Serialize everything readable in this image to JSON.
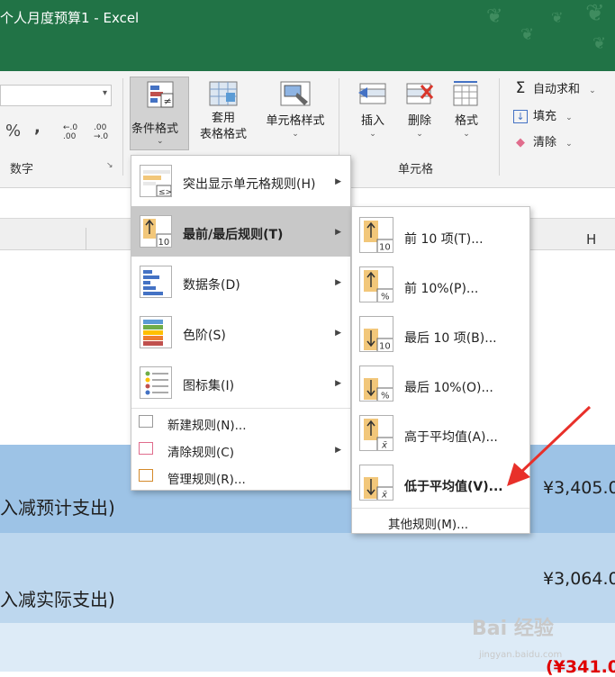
{
  "window": {
    "title": "个人月度预算1  -  Excel"
  },
  "ribbon": {
    "number_group": {
      "label": "数字",
      "percent": "%",
      "comma": ",",
      "inc_decimal": "←.0\n.00",
      "dec_decimal": ".00\n→.0"
    },
    "cond_format": {
      "label": "条件格式"
    },
    "table_format": {
      "label": "套用\n表格格式"
    },
    "cell_style": {
      "label": "单元格样式"
    },
    "insert": {
      "label": "插入"
    },
    "delete": {
      "label": "删除"
    },
    "format": {
      "label": "格式"
    },
    "cells_group": {
      "label": "单元格"
    },
    "autosum": {
      "label": "自动求和"
    },
    "fill": {
      "label": "填充"
    },
    "clear": {
      "label": "清除"
    }
  },
  "sheet": {
    "col_h": "H",
    "row1": {
      "text": "入减预计支出)",
      "amount": "¥3,405.0"
    },
    "row2": {
      "text": "入减实际支出)",
      "amount": "¥3,064.0"
    },
    "row3": {
      "amount": "(¥341.0"
    }
  },
  "cf_menu": {
    "items": [
      {
        "label": "突出显示单元格规则(H)",
        "icon": "highlight-rules-icon"
      },
      {
        "label": "最前/最后规则(T)",
        "icon": "top-bottom-rules-icon"
      },
      {
        "label": "数据条(D)",
        "icon": "data-bars-icon"
      },
      {
        "label": "色阶(S)",
        "icon": "color-scales-icon"
      },
      {
        "label": "图标集(I)",
        "icon": "icon-sets-icon"
      }
    ],
    "small_items": [
      {
        "label": "新建规则(N)...",
        "icon": "new-rule-icon"
      },
      {
        "label": "清除规则(C)",
        "icon": "clear-rules-icon"
      },
      {
        "label": "管理规则(R)...",
        "icon": "manage-rules-icon"
      }
    ]
  },
  "topbottom_menu": {
    "items": [
      {
        "label": "前 10 项(T)...",
        "badge": "10",
        "dir": "up"
      },
      {
        "label": "前 10%(P)...",
        "badge": "%",
        "dir": "up"
      },
      {
        "label": "最后 10 项(B)...",
        "badge": "10",
        "dir": "down"
      },
      {
        "label": "最后 10%(O)...",
        "badge": "%",
        "dir": "down"
      },
      {
        "label": "高于平均值(A)...",
        "badge": "x̄",
        "dir": "up"
      },
      {
        "label": "低于平均值(V)...",
        "badge": "x̄",
        "dir": "down"
      }
    ],
    "more": "其他规则(M)..."
  },
  "watermark": {
    "brand": "Bai 经验",
    "url": "jingyan.baidu.com"
  },
  "colors": {
    "excel_green": "#217346",
    "band_dark": "#9dc3e6",
    "band_light": "#bdd7ee",
    "annotation_red": "#e8302a",
    "negative_red": "#e00000"
  }
}
